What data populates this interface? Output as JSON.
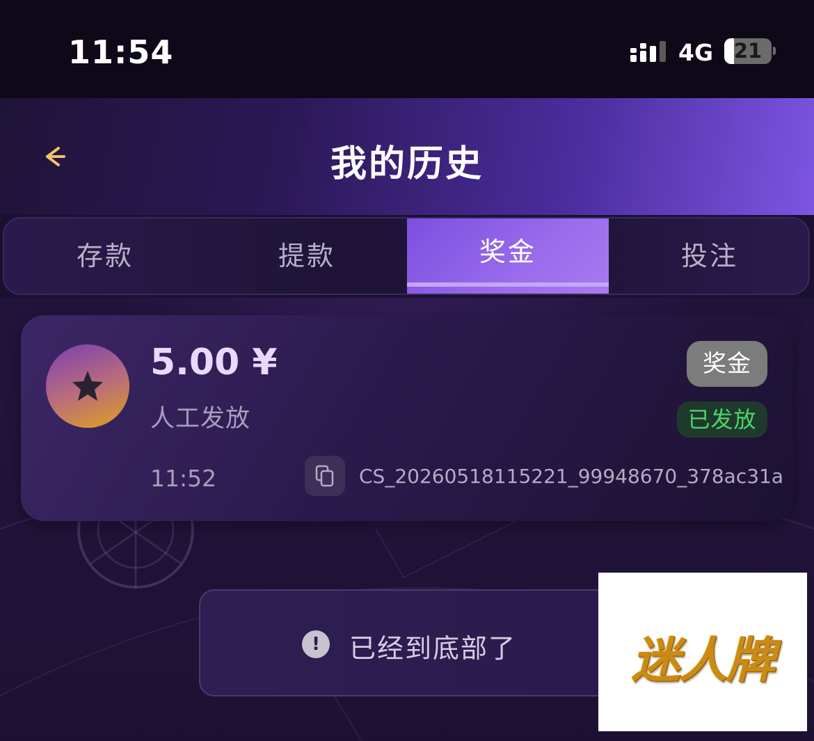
{
  "status_bar": {
    "time": "11:54",
    "network": "4G",
    "battery": "21"
  },
  "header": {
    "title": "我的历史"
  },
  "tabs": [
    {
      "label": "存款"
    },
    {
      "label": "提款"
    },
    {
      "label": "奖金"
    },
    {
      "label": "投注"
    }
  ],
  "active_tab": "奖金",
  "record": {
    "amount": "5.00 ¥",
    "source": "人工发放",
    "time": "11:52",
    "type_badge": "奖金",
    "status_badge": "已发放",
    "order_id": "CS_20260518115221_99948670_378ac31a"
  },
  "list_end_message": "已经到底部了",
  "watermark": {
    "text": "迷人牌"
  },
  "colors": {
    "accent": "#8a5ce8",
    "status_success": "#4cd36b",
    "back_arrow": "#f2c46a"
  }
}
